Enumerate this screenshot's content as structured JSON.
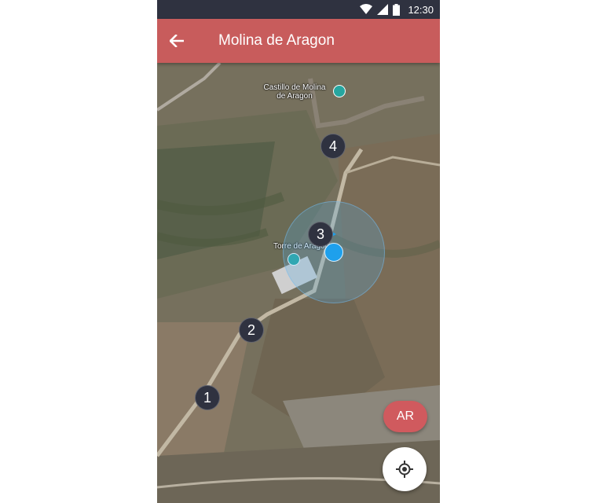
{
  "status_bar": {
    "time": "12:30"
  },
  "app_bar": {
    "title": "Molina de Aragon",
    "back_icon": "arrow-left-icon"
  },
  "map": {
    "type": "satellite",
    "pois": [
      {
        "name": "Castillo de Molina de Aragon",
        "line1": "Castillo de Molina",
        "line2": "de Aragon"
      },
      {
        "name": "Torre de Aragon",
        "label": "Torre de Aragon"
      }
    ],
    "route_markers": [
      "1",
      "2",
      "3",
      "4"
    ]
  },
  "buttons": {
    "ar_label": "AR",
    "locate_icon": "my-location-icon"
  },
  "colors": {
    "accent": "#c85c5c",
    "status_bar": "#2f3240",
    "marker": "#2f3240",
    "user_location": "#1ea0ec"
  }
}
